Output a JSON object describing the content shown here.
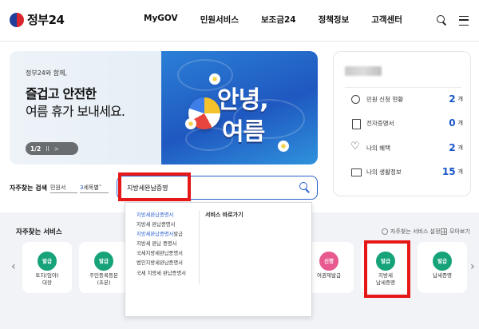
{
  "header": {
    "logo_text": "정부24",
    "nav": [
      "MyGOV",
      "민원서비스",
      "보조금24",
      "정책정보",
      "고객센터"
    ]
  },
  "banner": {
    "subtitle": "정부24와 함께,",
    "title_line1": "즐겁고 안전한",
    "title_line2": "여름 휴가 보내세요.",
    "big_line1": "안녕,",
    "big_line2": "여름",
    "pager": {
      "current": "1",
      "total": "2",
      "separator": "/",
      "pause": "II",
      "next": ">"
    }
  },
  "user_card": {
    "rows": [
      {
        "label": "민원 신청 현황",
        "value": "2",
        "unit": "개",
        "icon": "user-circle-icon"
      },
      {
        "label": "전자증명서",
        "value": "0",
        "unit": "개",
        "icon": "document-icon"
      },
      {
        "label": "나의 혜택",
        "value": "2",
        "unit": "개",
        "icon": "heart-icon"
      },
      {
        "label": "나의 생활정보",
        "value": "15",
        "unit": "개",
        "icon": "monitor-icon"
      }
    ]
  },
  "search": {
    "label": "자주찾는 검색",
    "select1": "민원서",
    "select2_blue": "3",
    "select2_rest": "세목별",
    "value": "지방세완납증명",
    "accent_color": "#2a5fd1"
  },
  "dropdown": {
    "items": [
      {
        "hl": "지방세완납증명서",
        "rest": ""
      },
      {
        "hl": "",
        "rest": "지방세 완납증명서"
      },
      {
        "hl": "지방세완납증명서",
        "rest": "발급"
      },
      {
        "hl": "",
        "rest": "지방세 완납 증명서"
      },
      {
        "hl": "",
        "rest": "국세지방세완납증명서"
      },
      {
        "hl": "",
        "rest": "법인지방세완납증명서"
      },
      {
        "hl": "",
        "rest": "국세 지방세 완납증명서"
      }
    ],
    "side_heading": "서비스 바로가기"
  },
  "favorites": {
    "title": "자주찾는 서비스",
    "setting_label": "자주찾는 서비스 설정",
    "more_label": "모아보기",
    "prev": "‹",
    "next": "›",
    "tiles": [
      {
        "badge": "발급",
        "line1": "토지(임야)",
        "line2": "대장",
        "color": "#16a37a"
      },
      {
        "badge": "발급",
        "line1": "주민등록등본",
        "line2": "(초본)",
        "color": "#16a37a"
      },
      {
        "badge": "신청",
        "line1": "여권재발급",
        "line2": "",
        "color": "#e85a8f"
      },
      {
        "badge": "발급",
        "line1": "지방세",
        "line2": "납세증명",
        "color": "#16a37a"
      },
      {
        "badge": "발급",
        "line1": "납세증명",
        "line2": "",
        "color": "#16a37a"
      }
    ]
  },
  "highlight_color": "#e61717"
}
